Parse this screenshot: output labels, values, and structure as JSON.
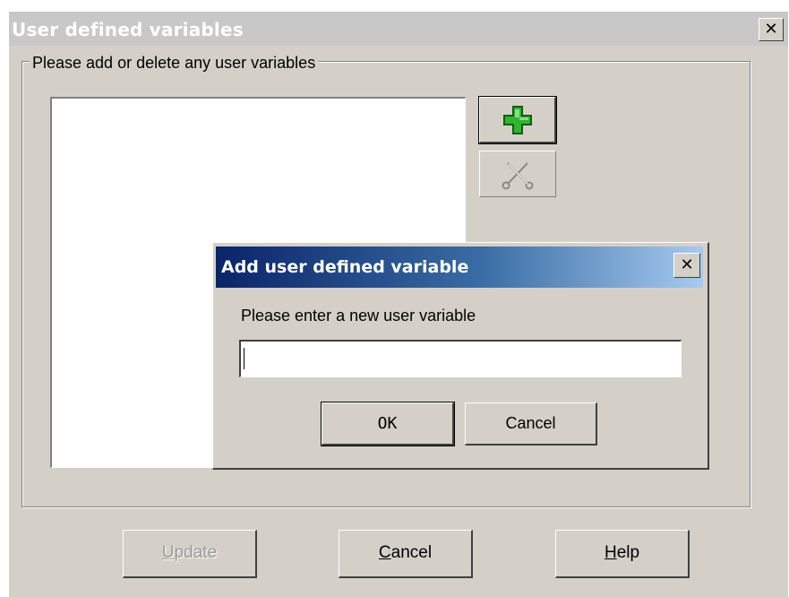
{
  "main_dialog": {
    "title": "User defined variables",
    "close_glyph": "✕",
    "group_label": "Please add or delete any user variables",
    "toolbar": {
      "add_icon": "green-plus-icon",
      "delete_icon": "scissors-icon"
    },
    "buttons": {
      "update": {
        "pre": "",
        "accel": "U",
        "post": "pdate",
        "enabled": false
      },
      "cancel": {
        "pre": "",
        "accel": "C",
        "post": "ancel",
        "enabled": true
      },
      "help": {
        "pre": "",
        "accel": "H",
        "post": "elp",
        "enabled": true
      }
    }
  },
  "add_dialog": {
    "title": "Add user defined variable",
    "close_glyph": "✕",
    "prompt": "Please enter a new user variable",
    "input_value": "",
    "ok_label": "OK",
    "cancel_label": "Cancel"
  },
  "colors": {
    "face": "#d4d0c8",
    "active_title_start": "#0a246a",
    "active_title_end": "#a6caf0",
    "inactive_title": "#c8c8c8",
    "add_icon_green": "#2fb52f"
  }
}
